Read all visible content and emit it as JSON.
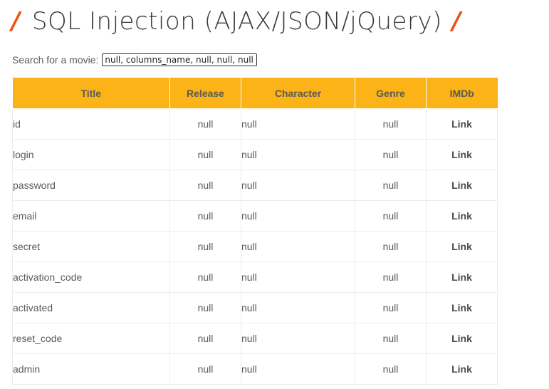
{
  "page": {
    "title": "SQL Injection (AJAX/JSON/jQuery)",
    "slash": "/"
  },
  "search": {
    "label": "Search for a movie:",
    "value": "null, columns_name, null, null, null"
  },
  "table": {
    "headers": [
      "Title",
      "Release",
      "Character",
      "Genre",
      "IMDb"
    ],
    "rows": [
      {
        "title": "id",
        "release": "null",
        "character": "null",
        "genre": "null",
        "imdb": "Link"
      },
      {
        "title": "login",
        "release": "null",
        "character": "null",
        "genre": "null",
        "imdb": "Link"
      },
      {
        "title": "password",
        "release": "null",
        "character": "null",
        "genre": "null",
        "imdb": "Link"
      },
      {
        "title": "email",
        "release": "null",
        "character": "null",
        "genre": "null",
        "imdb": "Link"
      },
      {
        "title": "secret",
        "release": "null",
        "character": "null",
        "genre": "null",
        "imdb": "Link"
      },
      {
        "title": "activation_code",
        "release": "null",
        "character": "null",
        "genre": "null",
        "imdb": "Link"
      },
      {
        "title": "activated",
        "release": "null",
        "character": "null",
        "genre": "null",
        "imdb": "Link"
      },
      {
        "title": "reset_code",
        "release": "null",
        "character": "null",
        "genre": "null",
        "imdb": "Link"
      },
      {
        "title": "admin",
        "release": "null",
        "character": "null",
        "genre": "null",
        "imdb": "Link"
      }
    ]
  },
  "colors": {
    "header_bg": "#fbb317",
    "slash": "#f04e12",
    "title_text": "#3a3a3a"
  }
}
